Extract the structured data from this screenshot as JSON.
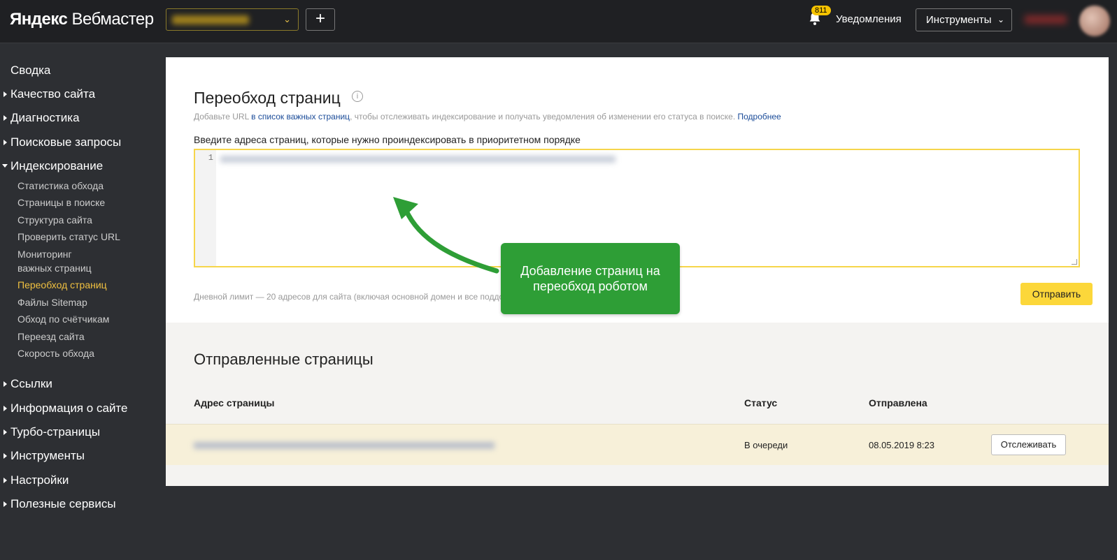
{
  "header": {
    "logo_brand": "Яндекс",
    "logo_product": "Вебмастер",
    "add_label": "+",
    "notifications_count": "811",
    "notifications_label": "Уведомления",
    "tools_label": "Инструменты"
  },
  "sidebar": {
    "top_items": [
      {
        "label": "Сводка"
      },
      {
        "label": "Качество сайта"
      },
      {
        "label": "Диагностика"
      },
      {
        "label": "Поисковые запросы"
      },
      {
        "label": "Индексирование"
      },
      {
        "label": "Ссылки"
      },
      {
        "label": "Информация о сайте"
      },
      {
        "label": "Турбо-страницы"
      },
      {
        "label": "Инструменты"
      },
      {
        "label": "Настройки"
      },
      {
        "label": "Полезные сервисы"
      }
    ],
    "indexing_items": [
      {
        "label": "Статистика обхода"
      },
      {
        "label": "Страницы в поиске"
      },
      {
        "label": "Структура сайта"
      },
      {
        "label": "Проверить статус URL"
      },
      {
        "label": "Мониторинг"
      },
      {
        "label": "важных страниц"
      },
      {
        "label": "Переобход страниц"
      },
      {
        "label": "Файлы Sitemap"
      },
      {
        "label": "Обход по счётчикам"
      },
      {
        "label": "Переезд сайта"
      },
      {
        "label": "Скорость обхода"
      }
    ]
  },
  "main": {
    "title": "Переобход страниц",
    "info_glyph": "i",
    "desc_before": "Добавьте URL ",
    "desc_link": "в список важных страниц",
    "desc_after": ", чтобы отслеживать индексирование и получать уведомления об изменении его статуса в поиске. ",
    "desc_more": "Подробнее",
    "input_label": "Введите адреса страниц, которые нужно проиндексировать в приоритетном порядке",
    "line_number": "1",
    "limit_text": "Дневной лимит — 20 адресов для сайта (включая основной домен и все поддомены). Можно отправить ещё 19 адресов.",
    "send_label": "Отправить"
  },
  "sent": {
    "title": "Отправленные страницы",
    "columns": [
      "Адрес страницы",
      "Статус",
      "Отправлена"
    ],
    "rows": [
      {
        "status": "В очереди",
        "date": "08.05.2019 8:23",
        "action": "Отслеживать"
      }
    ]
  },
  "callout": {
    "text": "Добавление страниц на переобход роботом"
  },
  "colors": {
    "accent": "#fcd73a",
    "active_nav": "#f0c040",
    "callout": "#2e9e36",
    "link": "#1a4b98"
  },
  "icons": [
    "bell-icon",
    "chevron-down-icon",
    "info-icon",
    "arrow-icon"
  ]
}
